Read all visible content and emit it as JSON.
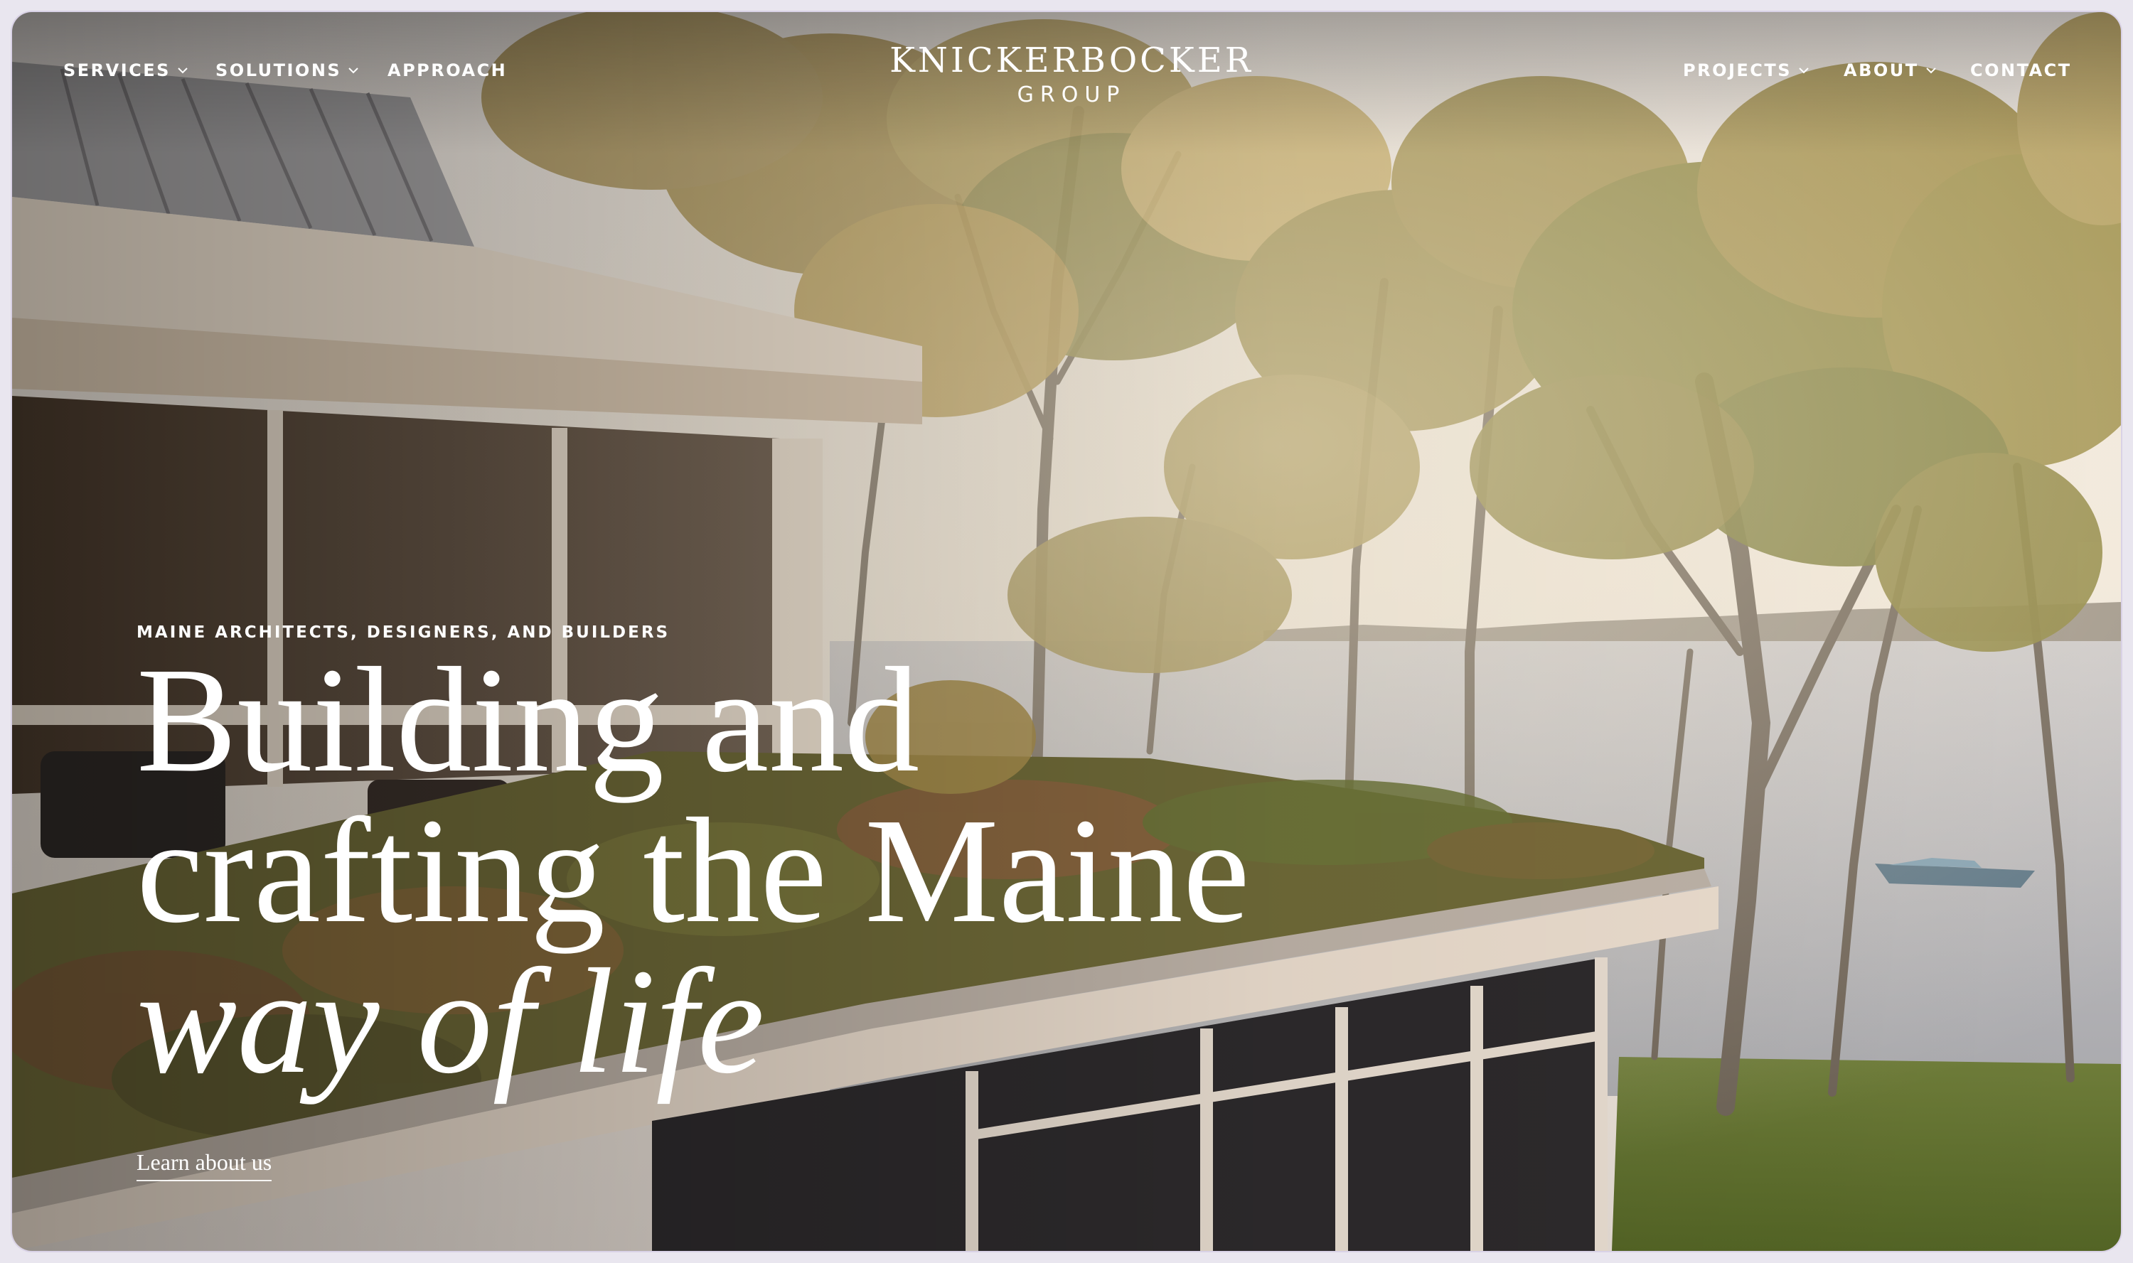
{
  "nav": {
    "left": [
      {
        "label": "SERVICES",
        "has_dropdown": true
      },
      {
        "label": "SOLUTIONS",
        "has_dropdown": true
      },
      {
        "label": "APPROACH",
        "has_dropdown": false
      }
    ],
    "right": [
      {
        "label": "PROJECTS",
        "has_dropdown": true
      },
      {
        "label": "ABOUT",
        "has_dropdown": true
      },
      {
        "label": "CONTACT",
        "has_dropdown": false
      }
    ]
  },
  "logo": {
    "name": "KNICKERBOCKER",
    "sub": "GROUP"
  },
  "hero": {
    "eyebrow": "MAINE ARCHITECTS, DESIGNERS, AND BUILDERS",
    "headline_line1": "Building and",
    "headline_line2": "crafting the Maine",
    "headline_line3": "way of life",
    "cta": "Learn about us"
  },
  "colors": {
    "text": "#ffffff",
    "background": "#e9e6ef"
  }
}
